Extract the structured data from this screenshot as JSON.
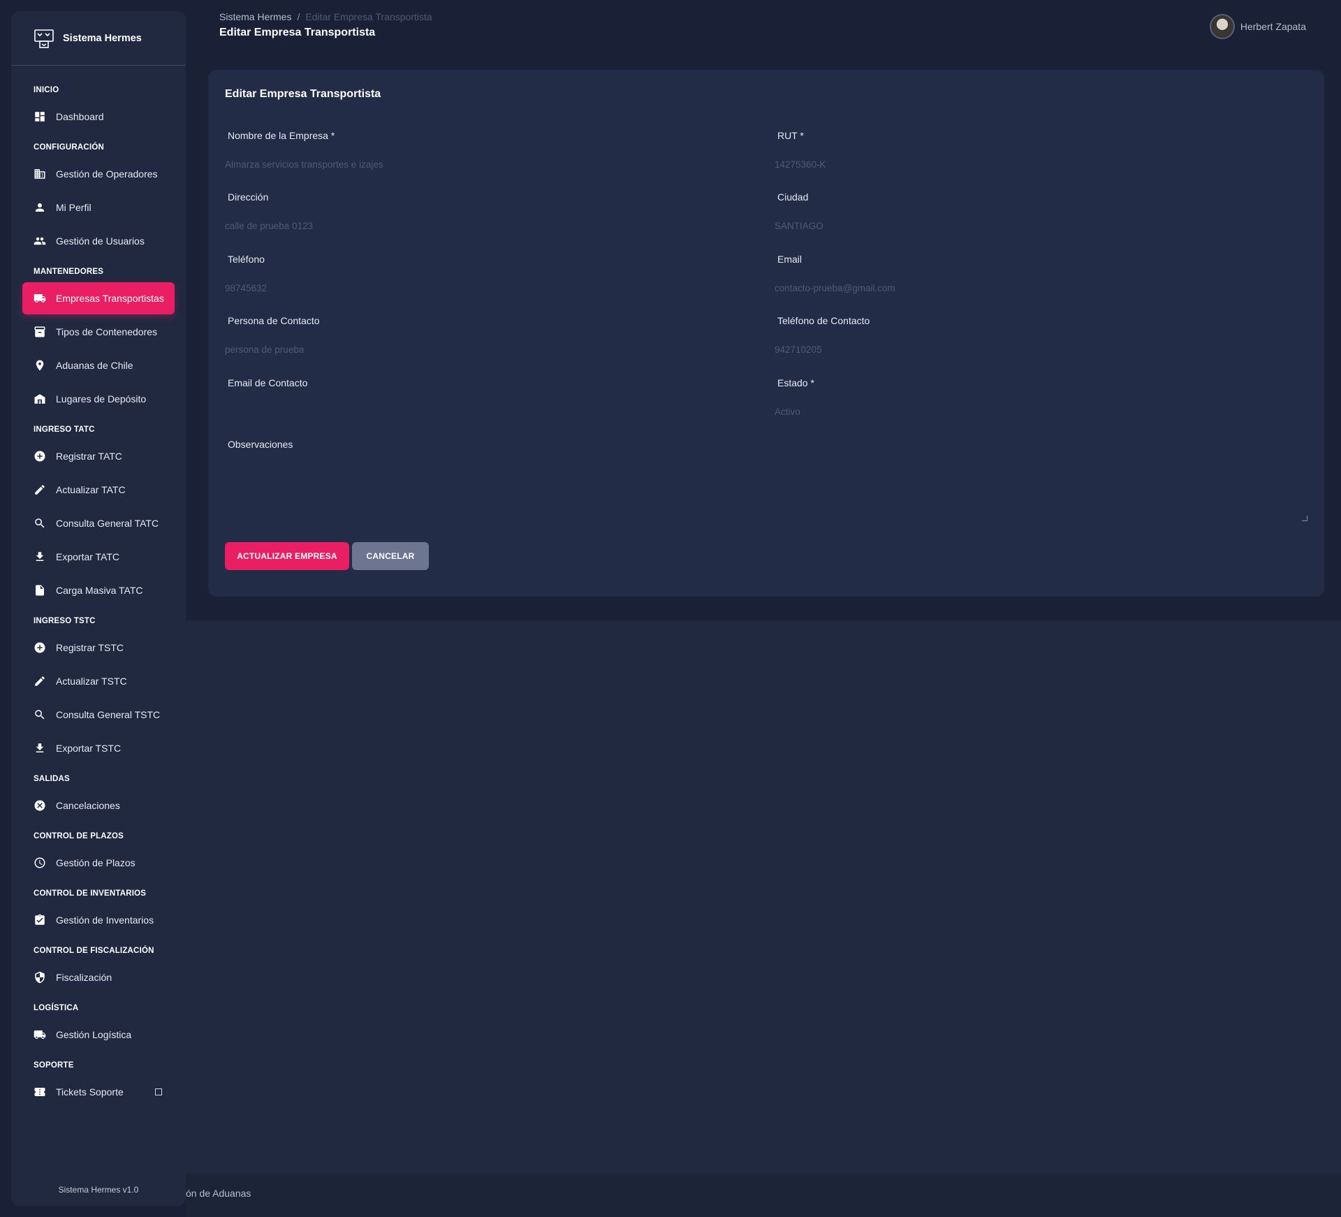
{
  "app": {
    "brand": "Sistema Hermes",
    "version": "Sistema Hermes v1.0"
  },
  "sidebar": {
    "sections": [
      {
        "title": "INICIO",
        "items": [
          {
            "label": "Dashboard",
            "icon": "dashboard-icon"
          }
        ]
      },
      {
        "title": "CONFIGURACIÓN",
        "items": [
          {
            "label": "Gestión de Operadores",
            "icon": "building-icon"
          },
          {
            "label": "Mi Perfil",
            "icon": "person-icon"
          },
          {
            "label": "Gestión de Usuarios",
            "icon": "people-icon"
          }
        ]
      },
      {
        "title": "MANTENEDORES",
        "items": [
          {
            "label": "Empresas Transportistas",
            "icon": "truck-icon",
            "active": true
          },
          {
            "label": "Tipos de Contenedores",
            "icon": "archive-icon"
          },
          {
            "label": "Aduanas de Chile",
            "icon": "location-pin-icon"
          },
          {
            "label": "Lugares de Depósito",
            "icon": "warehouse-icon"
          }
        ]
      },
      {
        "title": "INGRESO TATC",
        "items": [
          {
            "label": "Registrar TATC",
            "icon": "add-circle-icon"
          },
          {
            "label": "Actualizar TATC",
            "icon": "pencil-icon"
          },
          {
            "label": "Consulta General TATC",
            "icon": "search-icon"
          },
          {
            "label": "Exportar TATC",
            "icon": "download-icon"
          },
          {
            "label": "Carga Masiva TATC",
            "icon": "file-upload-icon"
          }
        ]
      },
      {
        "title": "INGRESO TSTC",
        "items": [
          {
            "label": "Registrar TSTC",
            "icon": "add-circle-icon"
          },
          {
            "label": "Actualizar TSTC",
            "icon": "pencil-icon"
          },
          {
            "label": "Consulta General TSTC",
            "icon": "search-icon"
          },
          {
            "label": "Exportar TSTC",
            "icon": "download-icon"
          }
        ]
      },
      {
        "title": "SALIDAS",
        "items": [
          {
            "label": "Cancelaciones",
            "icon": "cancel-circle-icon"
          }
        ]
      },
      {
        "title": "CONTROL DE PLAZOS",
        "items": [
          {
            "label": "Gestión de Plazos",
            "icon": "clock-icon"
          }
        ]
      },
      {
        "title": "CONTROL DE INVENTARIOS",
        "items": [
          {
            "label": "Gestión de Inventarios",
            "icon": "clipboard-check-icon"
          }
        ]
      },
      {
        "title": "CONTROL DE FISCALIZACIÓN",
        "items": [
          {
            "label": "Fiscalización",
            "icon": "shield-icon"
          }
        ]
      },
      {
        "title": "LOGÍSTICA",
        "items": [
          {
            "label": "Gestión Logística",
            "icon": "truck-icon"
          }
        ]
      },
      {
        "title": "SOPORTE",
        "items": [
          {
            "label": "Tickets Soporte",
            "icon": "ticket-icon",
            "external": true
          }
        ]
      }
    ]
  },
  "header": {
    "breadcrumb_root": "Sistema Hermes",
    "breadcrumb_sep": "/",
    "breadcrumb_current": "Editar Empresa Transportista",
    "title": "Editar Empresa Transportista",
    "user_name": "Herbert Zapata"
  },
  "form": {
    "title": "Editar Empresa Transportista",
    "fields": {
      "nombre": {
        "label": "Nombre de la Empresa *",
        "value": "Almarza servicios transportes e izajes"
      },
      "rut": {
        "label": "RUT *",
        "value": "14275360-K"
      },
      "direccion": {
        "label": "Dirección",
        "value": "calle de prueba  0123"
      },
      "ciudad": {
        "label": "Ciudad",
        "value": "SANTIAGO"
      },
      "telefono": {
        "label": "Teléfono",
        "value": "98745632"
      },
      "email": {
        "label": "Email",
        "value": "contacto-prueba@gmail.com"
      },
      "persona_contacto": {
        "label": "Persona de Contacto",
        "value": "persona de prueba"
      },
      "telefono_contacto": {
        "label": "Teléfono de Contacto",
        "value": "942710205"
      },
      "email_contacto": {
        "label": "Email de Contacto",
        "value": ""
      },
      "estado": {
        "label": "Estado *",
        "value": "Activo"
      },
      "observaciones": {
        "label": "Observaciones",
        "value": ""
      }
    },
    "submit_label": "ACTUALIZAR EMPRESA",
    "cancel_label": "CANCELAR"
  },
  "footer": {
    "text": "ón de Aduanas"
  },
  "colors": {
    "accent": "#e91e63",
    "background": "#1a2035",
    "card": "#222c46",
    "sidebar": "#202940"
  }
}
